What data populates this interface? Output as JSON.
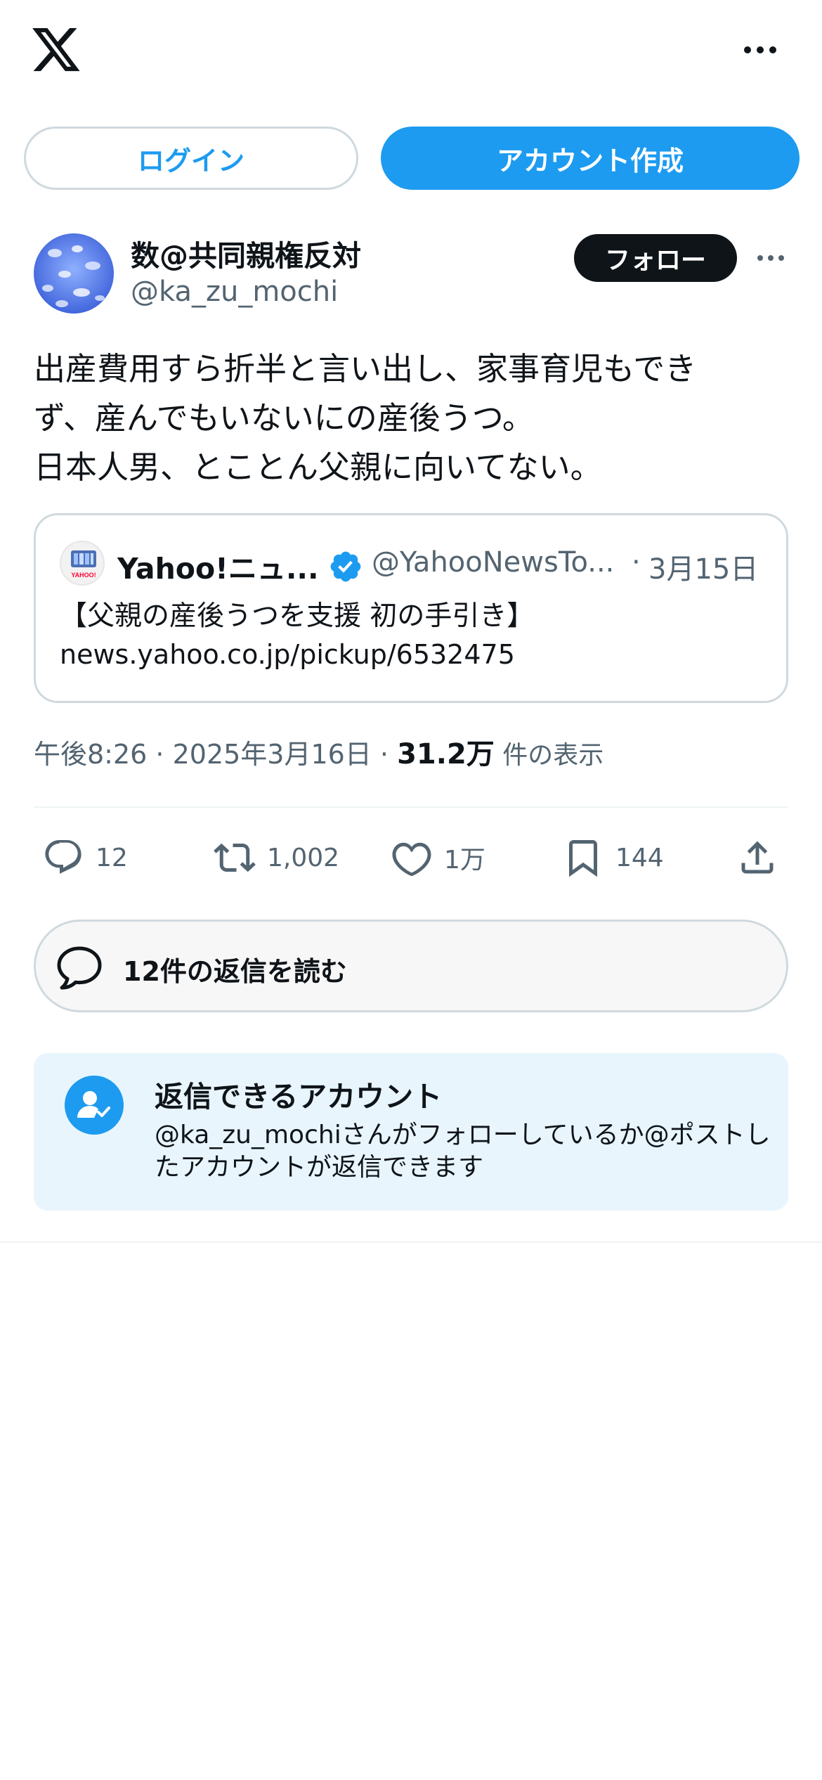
{
  "header": {
    "logo_icon": "x-logo-icon",
    "more_icon": "more-horizontal-icon"
  },
  "auth": {
    "login_label": "ログイン",
    "signup_label": "アカウント作成"
  },
  "author": {
    "display_name": "数@共同親権反対",
    "handle": "@ka_zu_mochi",
    "follow_label": "フォロー"
  },
  "tweet": {
    "lines": [
      "出産費用すら折半と言い出し、家事育児もでき",
      "ず、産んでもいないにの産後うつ。",
      "日本人男、とことん父親に向いてない。"
    ]
  },
  "quote": {
    "name": "Yahoo!ニュ...",
    "handle": "@YahooNewsTo...",
    "separator": "·",
    "date": "3月15日",
    "line1": "【父親の産後うつを支援 初の手引き】",
    "line2": "news.yahoo.co.jp/pickup/6532475",
    "avatar_text": "YAHOO!"
  },
  "meta": {
    "time": "午後8:26",
    "sep1": " · ",
    "date": "2025年3月16日",
    "sep2": " · ",
    "views": "31.2万",
    "views_label": " 件の表示"
  },
  "actions": {
    "replies": "12",
    "reposts": "1,002",
    "likes": "1万",
    "bookmarks": "144"
  },
  "read_replies": {
    "label": "12件の返信を読む"
  },
  "reply_notice": {
    "title": "返信できるアカウント",
    "body": "@ka_zu_mochiさんがフォローしているか@ポストしたアカウントが返信できます"
  },
  "colors": {
    "accent": "#1d9bf0",
    "text": "#0f1419",
    "muted": "#536471",
    "border": "#cfd9de",
    "notice_bg": "#e8f5fd"
  }
}
